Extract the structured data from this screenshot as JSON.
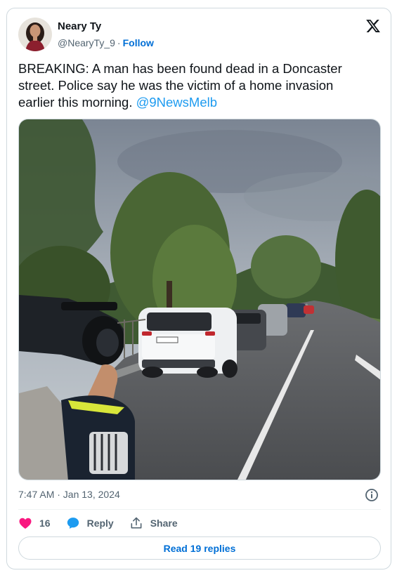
{
  "author": {
    "display_name": "Neary Ty",
    "handle": "@NearyTy_9",
    "separator": "·",
    "follow_label": "Follow"
  },
  "platform_logo": "x-logo-icon",
  "tweet": {
    "text": "BREAKING: A man has been found dead in a Doncaster street. Police say he was the victim of a home invasion earlier this morning. ",
    "mention": "@9NewsMelb",
    "media_alt": "Street scene with parked cars and camera operator"
  },
  "meta": {
    "timestamp": "7:47 AM · Jan 13, 2024"
  },
  "actions": {
    "like_count": "16",
    "reply_label": "Reply",
    "share_label": "Share"
  },
  "replies": {
    "label": "Read 19 replies"
  },
  "colors": {
    "link_blue": "#006fd6",
    "mention_blue": "#1d9bf0",
    "like_pink": "#f91880",
    "muted_text": "#536471",
    "border": "#cfd9de"
  }
}
